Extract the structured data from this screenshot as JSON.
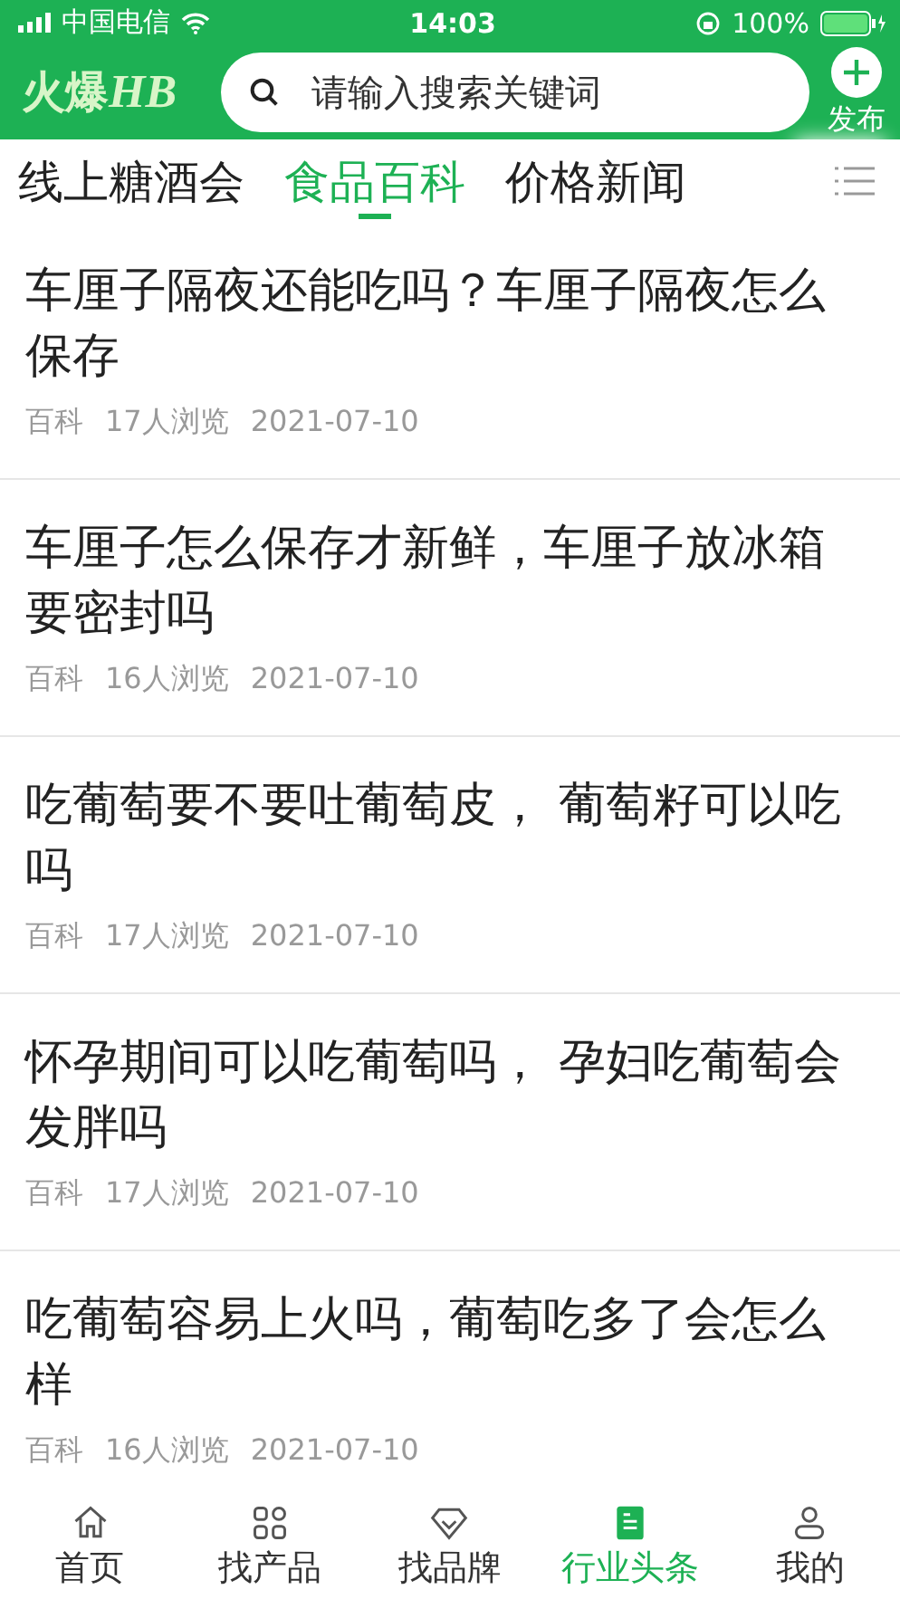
{
  "status_bar": {
    "carrier": "中国电信",
    "time": "14:03",
    "battery": "100%"
  },
  "header": {
    "logo": {
      "main": "火爆",
      "accent": "HB"
    },
    "search": {
      "placeholder": "请输入搜索关键词"
    },
    "publish": "发布"
  },
  "tabs": [
    {
      "label": "线上糖酒会",
      "selected": false
    },
    {
      "label": "食品百科",
      "selected": true
    },
    {
      "label": "价格新闻",
      "selected": false
    }
  ],
  "articles": [
    {
      "title": "车厘子隔夜还能吃吗？车厘子隔夜怎么保存",
      "category": "百科",
      "views": "17人浏览",
      "date": "2021-07-10"
    },
    {
      "title": "车厘子怎么保存才新鲜，车厘子放冰箱要密封吗",
      "category": "百科",
      "views": "16人浏览",
      "date": "2021-07-10"
    },
    {
      "title": "吃葡萄要不要吐葡萄皮， 葡萄籽可以吃吗",
      "category": "百科",
      "views": "17人浏览",
      "date": "2021-07-10"
    },
    {
      "title": "怀孕期间可以吃葡萄吗， 孕妇吃葡萄会发胖吗",
      "category": "百科",
      "views": "17人浏览",
      "date": "2021-07-10"
    },
    {
      "title": "吃葡萄容易上火吗，葡萄吃多了会怎么样",
      "category": "百科",
      "views": "16人浏览",
      "date": "2021-07-10"
    }
  ],
  "nav": [
    {
      "kind": "home",
      "label": "首页",
      "selected": false
    },
    {
      "kind": "grid",
      "label": "找产品",
      "selected": false
    },
    {
      "kind": "diamond",
      "label": "找品牌",
      "selected": false
    },
    {
      "kind": "news",
      "label": "行业头条",
      "selected": true
    },
    {
      "kind": "user",
      "label": "我的",
      "selected": false
    }
  ]
}
